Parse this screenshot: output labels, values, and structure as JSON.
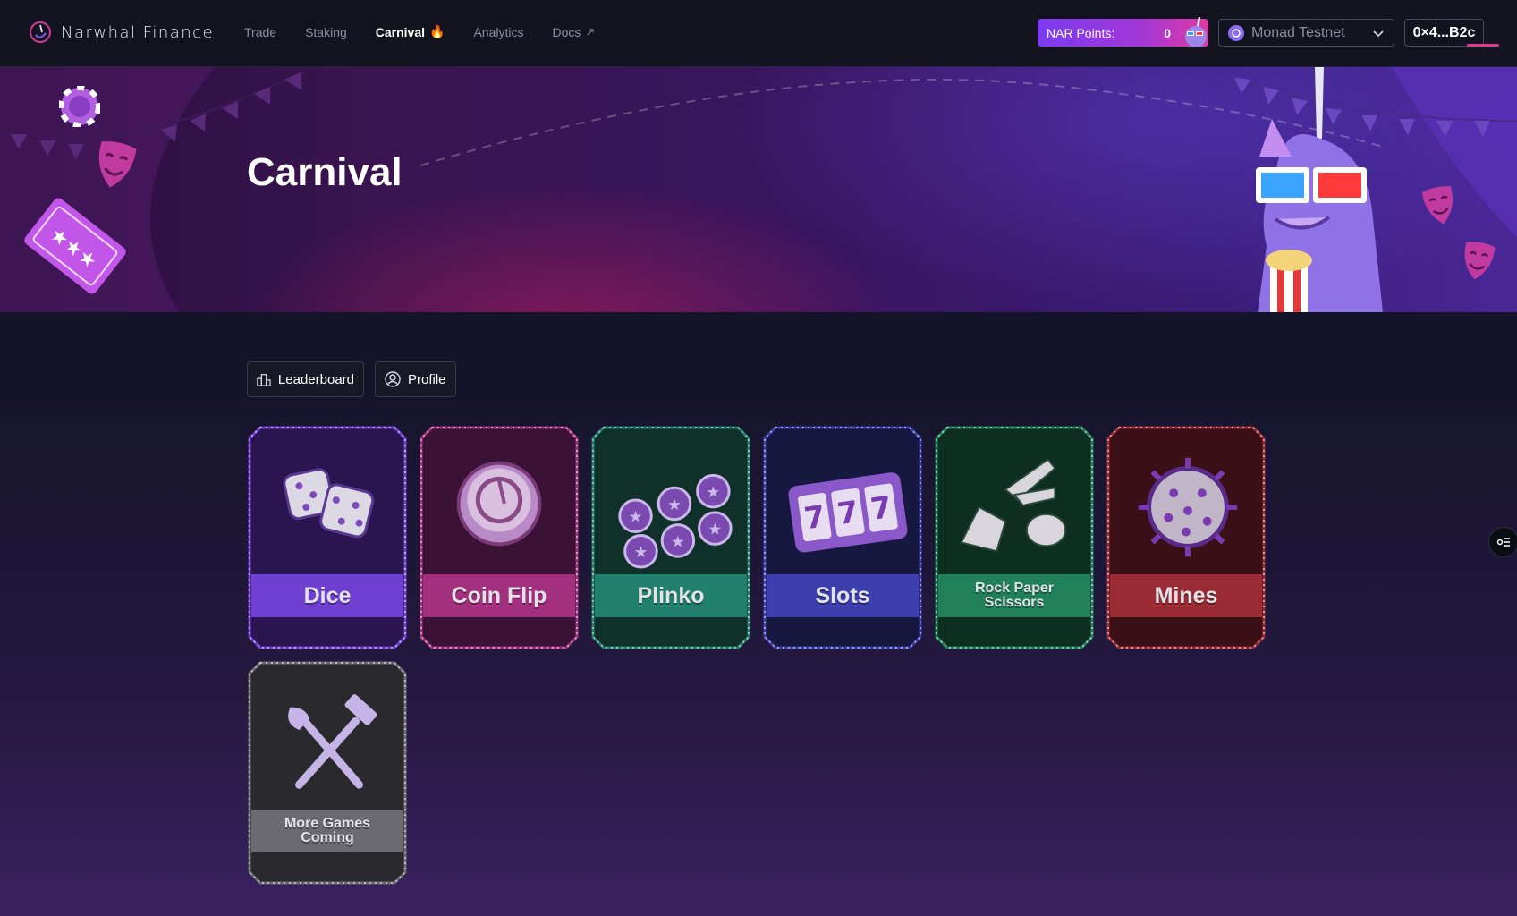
{
  "brand": {
    "name": "Narwhal Finance"
  },
  "nav": [
    {
      "label": "Trade",
      "active": false
    },
    {
      "label": "Staking",
      "active": false
    },
    {
      "label": "Carnival",
      "active": true,
      "icon": "flame-icon"
    },
    {
      "label": "Analytics",
      "active": false
    },
    {
      "label": "Docs",
      "active": false,
      "icon": "external-link-icon"
    }
  ],
  "points": {
    "label": "NAR Points:",
    "value": "0"
  },
  "network": {
    "label": "Monad Testnet"
  },
  "wallet": {
    "address": "0×4...B2c"
  },
  "hero": {
    "title": "Carnival"
  },
  "actions": {
    "leaderboard": "Leaderboard",
    "profile": "Profile"
  },
  "games": [
    {
      "label": "Dice",
      "color": "#6f3fd1",
      "bg": "#2b1550"
    },
    {
      "label": "Coin Flip",
      "color": "#a3307e",
      "bg": "#3a1236"
    },
    {
      "label": "Plinko",
      "color": "#21806b",
      "bg": "#10302a"
    },
    {
      "label": "Slots",
      "color": "#3d3fae",
      "bg": "#17183f"
    },
    {
      "label": "Rock Paper Scissors",
      "color": "#21805a",
      "bg": "#0f2e22"
    },
    {
      "label": "Mines",
      "color": "#9a2b35",
      "bg": "#3a1016"
    },
    {
      "label": "More Games Coming",
      "color": "#6a6a70",
      "bg": "#2a2a2e"
    }
  ]
}
